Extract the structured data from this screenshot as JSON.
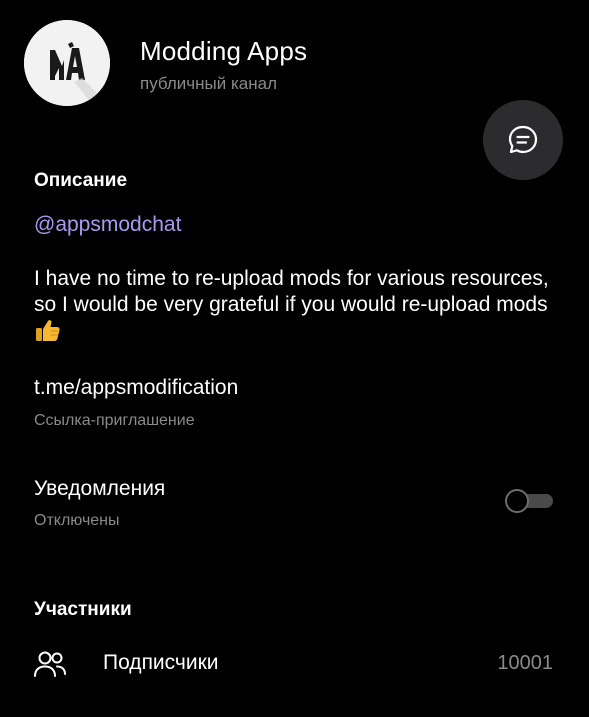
{
  "header": {
    "channel_name": "Modding Apps",
    "channel_type": "публичный канал",
    "avatar_logo_text": "MA"
  },
  "description_section": {
    "title": "Описание",
    "username_link": "@appsmodchat",
    "text": "I have no time to re-upload mods for various resources, so I would be very grateful if you would re-upload mods",
    "trailing_emoji_icon": "thumbs-up-emoji"
  },
  "invite": {
    "link": "t.me/appsmodification",
    "label": "Ссылка-приглашение"
  },
  "notifications": {
    "title": "Уведомления",
    "status": "Отключены",
    "enabled": false
  },
  "members_section": {
    "title": "Участники",
    "subscribers_label": "Подписчики",
    "subscribers_count": "10001",
    "icon": "people-icon"
  },
  "colors": {
    "background": "#000000",
    "link": "#a99af0",
    "secondary_text": "#8a8a8a",
    "fab": "#2c2c2e"
  }
}
